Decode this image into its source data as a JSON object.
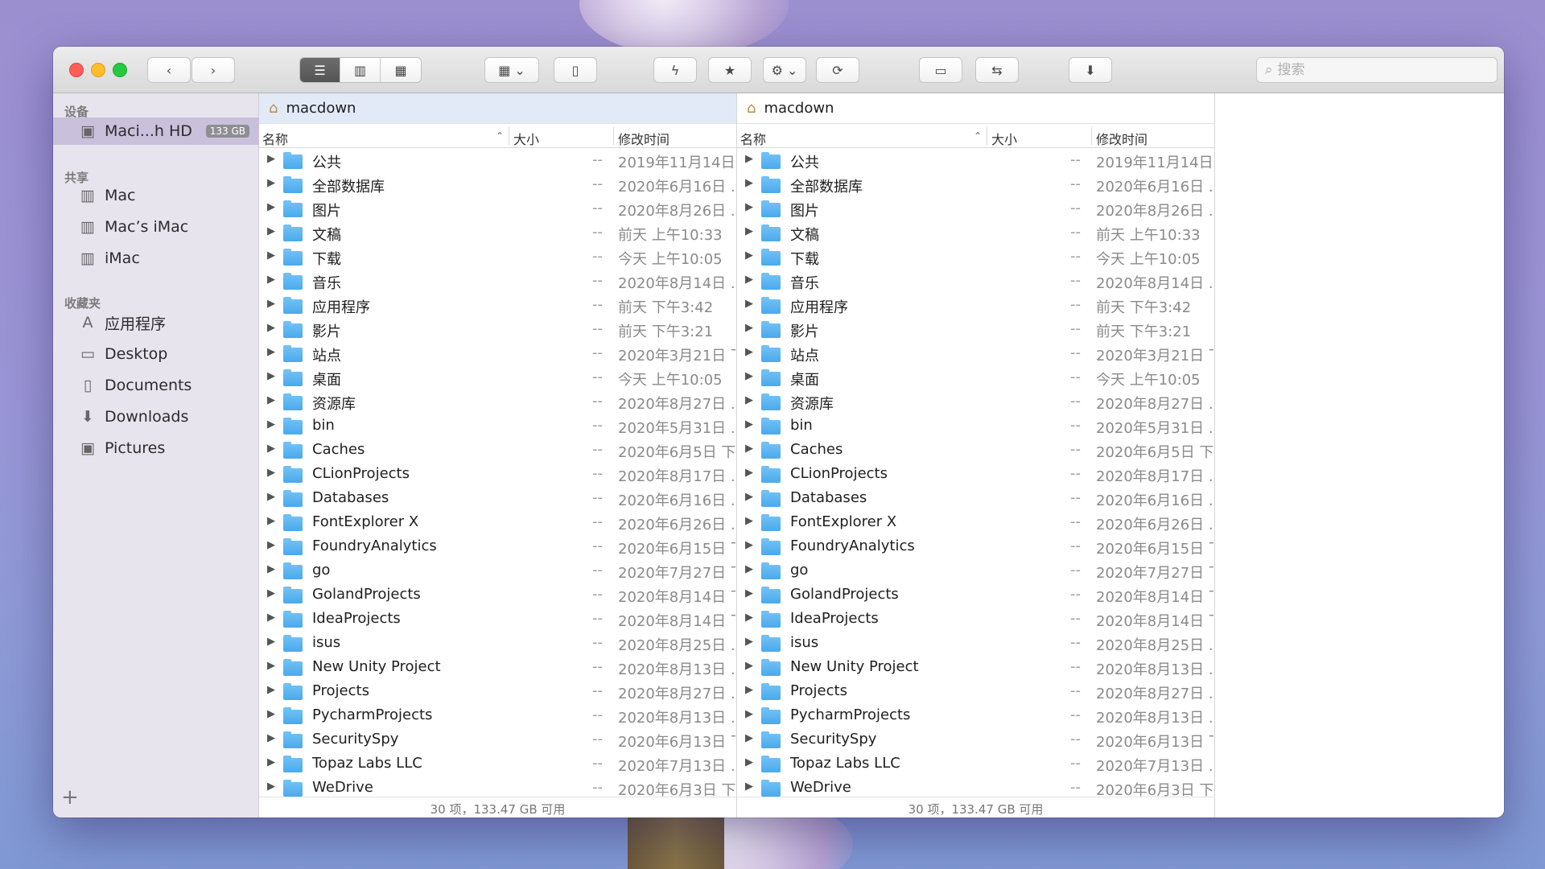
{
  "toolbar": {
    "search_placeholder": "搜索"
  },
  "sidebar": {
    "sections": {
      "devices": "设备",
      "shared": "共享",
      "favorites": "收藏夹"
    },
    "devices": [
      {
        "label": "Maci...h HD",
        "badge": "133 GB",
        "icon": "disk-icon"
      }
    ],
    "shared": [
      {
        "label": "Mac",
        "icon": "display-icon"
      },
      {
        "label": "Mac’s iMac",
        "icon": "display-icon"
      },
      {
        "label": "iMac",
        "icon": "display-icon"
      }
    ],
    "favorites": [
      {
        "label": "应用程序",
        "icon": "applications-icon"
      },
      {
        "label": "Desktop",
        "icon": "desktop-icon"
      },
      {
        "label": "Documents",
        "icon": "documents-icon"
      },
      {
        "label": "Downloads",
        "icon": "downloads-icon"
      },
      {
        "label": "Pictures",
        "icon": "pictures-icon"
      }
    ],
    "add_label": "+"
  },
  "panes": [
    {
      "path": "macdown",
      "columns": {
        "name": "名称",
        "size": "大小",
        "modified": "修改时间"
      },
      "status": "30 项，133.47 GB 可用",
      "rows": [
        {
          "name": "公共",
          "size": "--",
          "date": "2019年11月14日"
        },
        {
          "name": "全部数据库",
          "size": "--",
          "date": "2020年6月16日 ..."
        },
        {
          "name": "图片",
          "size": "--",
          "date": "2020年8月26日 ..."
        },
        {
          "name": "文稿",
          "size": "--",
          "date": "前天 上午10:33"
        },
        {
          "name": "下载",
          "size": "--",
          "date": "今天 上午10:05"
        },
        {
          "name": "音乐",
          "size": "--",
          "date": "2020年8月14日 ..."
        },
        {
          "name": "应用程序",
          "size": "--",
          "date": "前天 下午3:42"
        },
        {
          "name": "影片",
          "size": "--",
          "date": "前天 下午3:21"
        },
        {
          "name": "站点",
          "size": "--",
          "date": "2020年3月21日 下"
        },
        {
          "name": "桌面",
          "size": "--",
          "date": "今天 上午10:05"
        },
        {
          "name": "资源库",
          "size": "--",
          "date": "2020年8月27日 ..."
        },
        {
          "name": "bin",
          "size": "--",
          "date": "2020年5月31日 ..."
        },
        {
          "name": "Caches",
          "size": "--",
          "date": "2020年6月5日 下"
        },
        {
          "name": "CLionProjects",
          "size": "--",
          "date": "2020年8月17日 ..."
        },
        {
          "name": "Databases",
          "size": "--",
          "date": "2020年6月16日 ..."
        },
        {
          "name": "FontExplorer X",
          "size": "--",
          "date": "2020年6月26日 ..."
        },
        {
          "name": "FoundryAnalytics",
          "size": "--",
          "date": "2020年6月15日 下"
        },
        {
          "name": "go",
          "size": "--",
          "date": "2020年7月27日 下"
        },
        {
          "name": "GolandProjects",
          "size": "--",
          "date": "2020年8月14日 下"
        },
        {
          "name": "IdeaProjects",
          "size": "--",
          "date": "2020年8月14日 下"
        },
        {
          "name": "isus",
          "size": "--",
          "date": "2020年8月25日 ..."
        },
        {
          "name": "New Unity Project",
          "size": "--",
          "date": "2020年8月13日 ..."
        },
        {
          "name": "Projects",
          "size": "--",
          "date": "2020年8月27日 ..."
        },
        {
          "name": "PycharmProjects",
          "size": "--",
          "date": "2020年8月13日 ..."
        },
        {
          "name": "SecuritySpy",
          "size": "--",
          "date": "2020年6月13日 下"
        },
        {
          "name": "Topaz Labs LLC",
          "size": "--",
          "date": "2020年7月13日 ..."
        },
        {
          "name": "WeDrive",
          "size": "--",
          "date": "2020年6月3日 下"
        }
      ]
    },
    {
      "path": "macdown",
      "columns": {
        "name": "名称",
        "size": "大小",
        "modified": "修改时间"
      },
      "status": "30 项，133.47 GB 可用",
      "rows": [
        {
          "name": "公共",
          "size": "--",
          "date": "2019年11月14日"
        },
        {
          "name": "全部数据库",
          "size": "--",
          "date": "2020年6月16日 ..."
        },
        {
          "name": "图片",
          "size": "--",
          "date": "2020年8月26日 ..."
        },
        {
          "name": "文稿",
          "size": "--",
          "date": "前天 上午10:33"
        },
        {
          "name": "下载",
          "size": "--",
          "date": "今天 上午10:05"
        },
        {
          "name": "音乐",
          "size": "--",
          "date": "2020年8月14日 ..."
        },
        {
          "name": "应用程序",
          "size": "--",
          "date": "前天 下午3:42"
        },
        {
          "name": "影片",
          "size": "--",
          "date": "前天 下午3:21"
        },
        {
          "name": "站点",
          "size": "--",
          "date": "2020年3月21日 下"
        },
        {
          "name": "桌面",
          "size": "--",
          "date": "今天 上午10:05"
        },
        {
          "name": "资源库",
          "size": "--",
          "date": "2020年8月27日 ..."
        },
        {
          "name": "bin",
          "size": "--",
          "date": "2020年5月31日 ..."
        },
        {
          "name": "Caches",
          "size": "--",
          "date": "2020年6月5日 下"
        },
        {
          "name": "CLionProjects",
          "size": "--",
          "date": "2020年8月17日 ..."
        },
        {
          "name": "Databases",
          "size": "--",
          "date": "2020年6月16日 ..."
        },
        {
          "name": "FontExplorer X",
          "size": "--",
          "date": "2020年6月26日 ..."
        },
        {
          "name": "FoundryAnalytics",
          "size": "--",
          "date": "2020年6月15日 下"
        },
        {
          "name": "go",
          "size": "--",
          "date": "2020年7月27日 下"
        },
        {
          "name": "GolandProjects",
          "size": "--",
          "date": "2020年8月14日 下"
        },
        {
          "name": "IdeaProjects",
          "size": "--",
          "date": "2020年8月14日 下"
        },
        {
          "name": "isus",
          "size": "--",
          "date": "2020年8月25日 ..."
        },
        {
          "name": "New Unity Project",
          "size": "--",
          "date": "2020年8月13日 ..."
        },
        {
          "name": "Projects",
          "size": "--",
          "date": "2020年8月27日 ..."
        },
        {
          "name": "PycharmProjects",
          "size": "--",
          "date": "2020年8月13日 ..."
        },
        {
          "name": "SecuritySpy",
          "size": "--",
          "date": "2020年6月13日 下"
        },
        {
          "name": "Topaz Labs LLC",
          "size": "--",
          "date": "2020年7月13日 ..."
        },
        {
          "name": "WeDrive",
          "size": "--",
          "date": "2020年6月3日 下"
        }
      ]
    }
  ]
}
